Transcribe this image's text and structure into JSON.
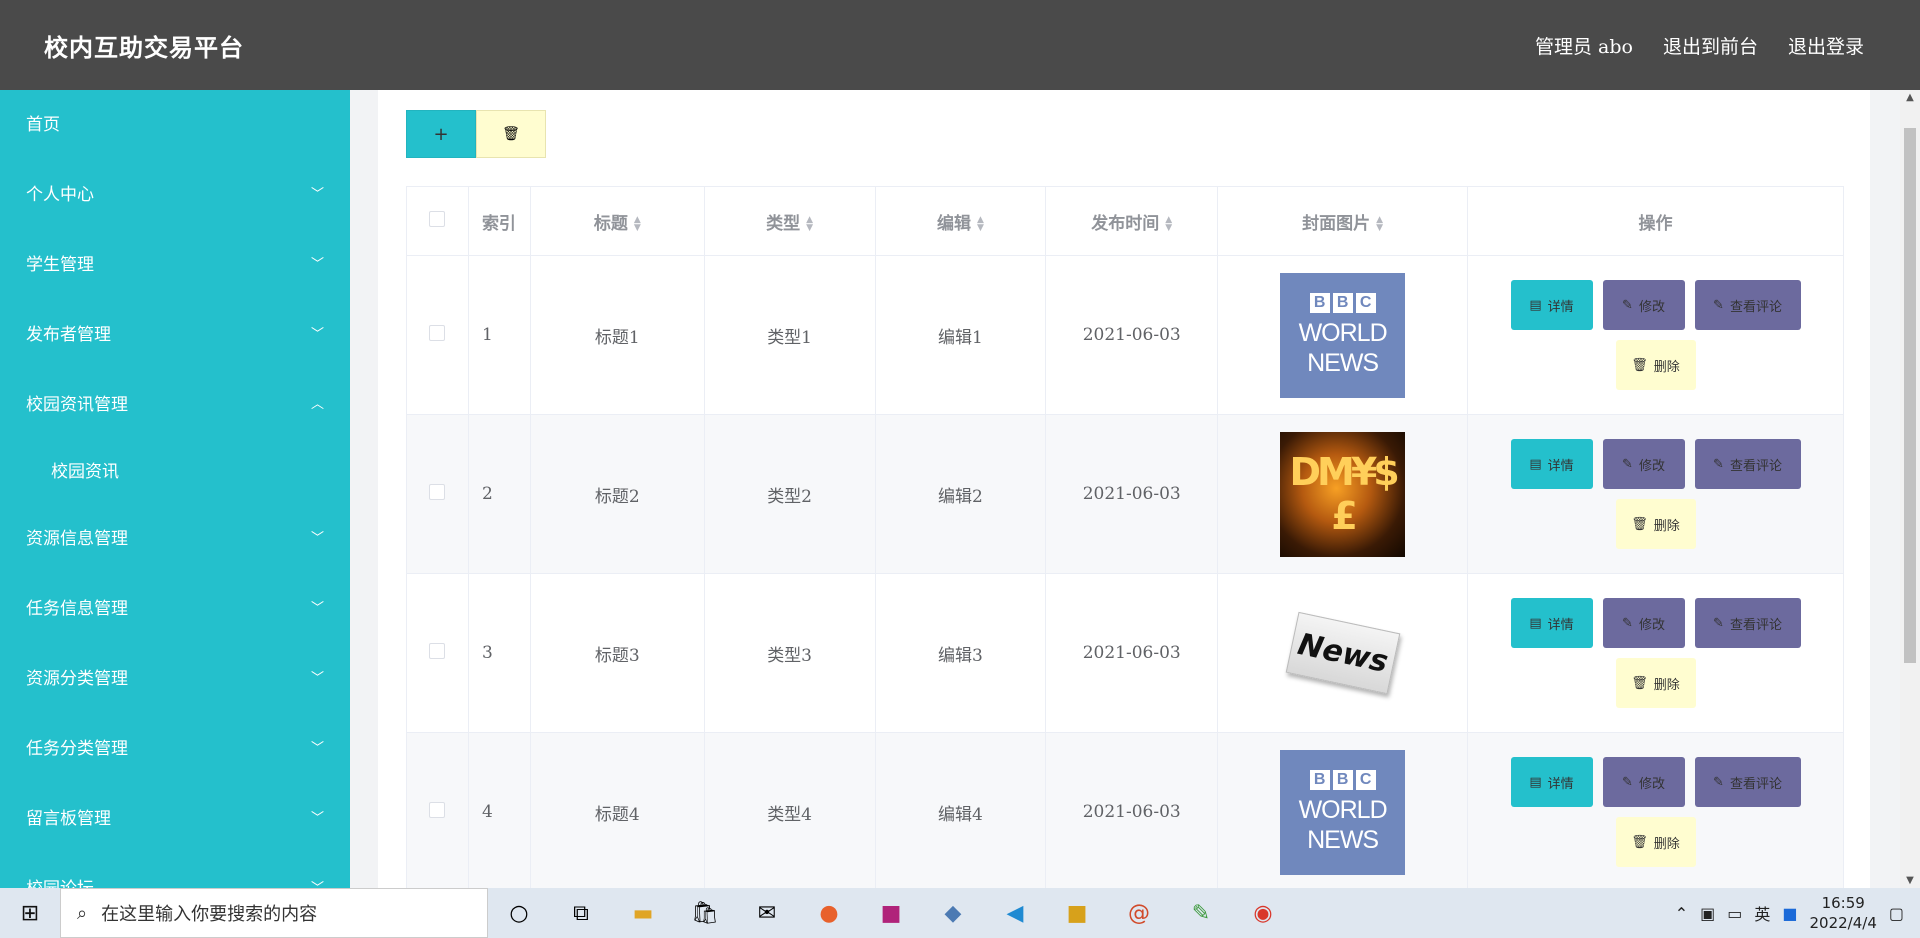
{
  "header": {
    "brand": "校内互助交易平台",
    "admin": "管理员 abo",
    "to_front": "退出到前台",
    "logout": "退出登录"
  },
  "sidebar": {
    "items": [
      {
        "label": "首页",
        "chevron": ""
      },
      {
        "label": "个人中心",
        "chevron": "﹀"
      },
      {
        "label": "学生管理",
        "chevron": "﹀"
      },
      {
        "label": "发布者管理",
        "chevron": "﹀"
      },
      {
        "label": "校园资讯管理",
        "chevron": "︿"
      },
      {
        "label": "校园资讯",
        "chevron": ""
      },
      {
        "label": "资源信息管理",
        "chevron": "﹀"
      },
      {
        "label": "任务信息管理",
        "chevron": "﹀"
      },
      {
        "label": "资源分类管理",
        "chevron": "﹀"
      },
      {
        "label": "任务分类管理",
        "chevron": "﹀"
      },
      {
        "label": "留言板管理",
        "chevron": "﹀"
      },
      {
        "label": "校园论坛",
        "chevron": "﹀"
      }
    ]
  },
  "toolbar": {
    "add_label": "+",
    "delete_icon": "🗑"
  },
  "table": {
    "headers": {
      "index": "索引",
      "title": "标题",
      "type": "类型",
      "editor": "编辑",
      "time": "发布时间",
      "cover": "封面图片",
      "ops": "操作"
    },
    "rows": [
      {
        "index": "1",
        "title": "标题1",
        "type": "类型1",
        "editor": "编辑1",
        "time": "2021-06-03",
        "cover": "bbc"
      },
      {
        "index": "2",
        "title": "标题2",
        "type": "类型2",
        "editor": "编辑2",
        "time": "2021-06-03",
        "cover": "money"
      },
      {
        "index": "3",
        "title": "标题3",
        "type": "类型3",
        "editor": "编辑3",
        "time": "2021-06-03",
        "cover": "newspaper"
      },
      {
        "index": "4",
        "title": "标题4",
        "type": "类型4",
        "editor": "编辑4",
        "time": "2021-06-03",
        "cover": "bbc"
      }
    ],
    "op_labels": {
      "detail": "详情",
      "modify": "修改",
      "comments": "查看评论",
      "delete": "删除"
    },
    "cover_text": {
      "bbc_letters": [
        "B",
        "B",
        "C"
      ],
      "bbc_world": "WORLD",
      "bbc_news": "NEWS",
      "money": "DM¥$£",
      "newspaper": "News"
    }
  },
  "taskbar": {
    "search_placeholder": "在这里输入你要搜索的内容",
    "time": "16:59",
    "date": "2022/4/4",
    "tray_ime": "英"
  },
  "colors": {
    "accent": "#24c0cc",
    "header": "#4a4a4a",
    "purple": "#6c6a9e",
    "cream": "#fffdd0"
  }
}
